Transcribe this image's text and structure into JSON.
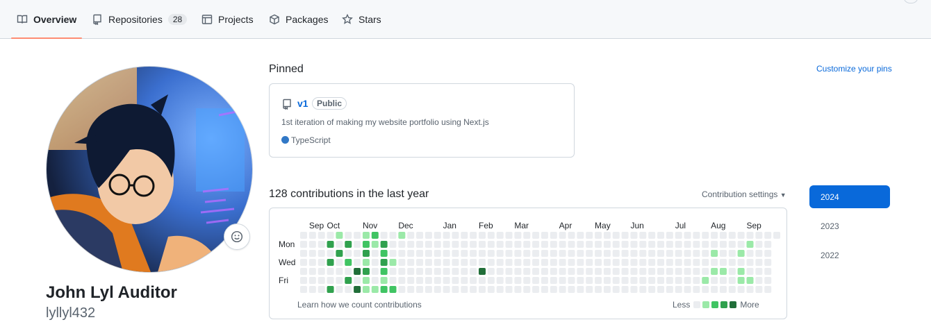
{
  "nav": {
    "tabs": [
      {
        "label": "Overview",
        "icon": "book-icon"
      },
      {
        "label": "Repositories",
        "count": "28",
        "icon": "repo-icon"
      },
      {
        "label": "Projects",
        "icon": "table-icon"
      },
      {
        "label": "Packages",
        "icon": "package-icon"
      },
      {
        "label": "Stars",
        "icon": "star-icon"
      }
    ]
  },
  "profile": {
    "name": "John Lyl Auditor",
    "login": "lyllyl432",
    "status_icon": "smiley-icon"
  },
  "pinned": {
    "title": "Pinned",
    "customize_label": "Customize your pins",
    "repos": [
      {
        "name": "v1",
        "visibility": "Public",
        "description": "1st iteration of making my website portfolio using Next.js",
        "language": "TypeScript",
        "language_color": "#3178c6"
      }
    ]
  },
  "contributions": {
    "title": "128 contributions in the last year",
    "settings_label": "Contribution settings",
    "learn_label": "Learn how we count contributions",
    "legend_less": "Less",
    "legend_more": "More",
    "day_labels": [
      "Mon",
      "Wed",
      "Fri"
    ],
    "months": [
      {
        "label": "Sep",
        "week": 1
      },
      {
        "label": "Oct",
        "week": 3
      },
      {
        "label": "Nov",
        "week": 7
      },
      {
        "label": "Dec",
        "week": 11
      },
      {
        "label": "Jan",
        "week": 16
      },
      {
        "label": "Feb",
        "week": 20
      },
      {
        "label": "Mar",
        "week": 24
      },
      {
        "label": "Apr",
        "week": 29
      },
      {
        "label": "May",
        "week": 33
      },
      {
        "label": "Jun",
        "week": 37
      },
      {
        "label": "Jul",
        "week": 42
      },
      {
        "label": "Aug",
        "week": 46
      },
      {
        "label": "Sep",
        "week": 50
      }
    ],
    "weeks": 54,
    "level_colors": [
      "#ebedf0",
      "#9be9a8",
      "#40c463",
      "#30a14e",
      "#216e39"
    ],
    "active_cells": [
      {
        "week": 11,
        "day": 0,
        "level": 1
      },
      {
        "week": 3,
        "day": 1,
        "level": 3
      },
      {
        "week": 4,
        "day": 0,
        "level": 1
      },
      {
        "week": 5,
        "day": 1,
        "level": 3
      },
      {
        "week": 4,
        "day": 2,
        "level": 3
      },
      {
        "week": 7,
        "day": 0,
        "level": 1
      },
      {
        "week": 8,
        "day": 0,
        "level": 2
      },
      {
        "week": 7,
        "day": 1,
        "level": 2
      },
      {
        "week": 8,
        "day": 1,
        "level": 1
      },
      {
        "week": 9,
        "day": 1,
        "level": 3
      },
      {
        "week": 7,
        "day": 2,
        "level": 3
      },
      {
        "week": 9,
        "day": 2,
        "level": 2
      },
      {
        "week": 3,
        "day": 3,
        "level": 3
      },
      {
        "week": 5,
        "day": 3,
        "level": 2
      },
      {
        "week": 7,
        "day": 3,
        "level": 1
      },
      {
        "week": 9,
        "day": 3,
        "level": 3
      },
      {
        "week": 10,
        "day": 3,
        "level": 1
      },
      {
        "week": 6,
        "day": 4,
        "level": 4
      },
      {
        "week": 7,
        "day": 4,
        "level": 3
      },
      {
        "week": 9,
        "day": 4,
        "level": 2
      },
      {
        "week": 20,
        "day": 4,
        "level": 4
      },
      {
        "week": 5,
        "day": 5,
        "level": 3
      },
      {
        "week": 7,
        "day": 5,
        "level": 1
      },
      {
        "week": 9,
        "day": 5,
        "level": 1
      },
      {
        "week": 3,
        "day": 6,
        "level": 3
      },
      {
        "week": 6,
        "day": 6,
        "level": 4
      },
      {
        "week": 7,
        "day": 6,
        "level": 1
      },
      {
        "week": 8,
        "day": 6,
        "level": 1
      },
      {
        "week": 9,
        "day": 6,
        "level": 2
      },
      {
        "week": 10,
        "day": 6,
        "level": 2
      },
      {
        "week": 50,
        "day": 1,
        "level": 1
      },
      {
        "week": 46,
        "day": 2,
        "level": 1
      },
      {
        "week": 49,
        "day": 2,
        "level": 1
      },
      {
        "week": 46,
        "day": 4,
        "level": 1
      },
      {
        "week": 47,
        "day": 4,
        "level": 1
      },
      {
        "week": 49,
        "day": 4,
        "level": 1
      },
      {
        "week": 45,
        "day": 5,
        "level": 1
      },
      {
        "week": 49,
        "day": 5,
        "level": 1
      },
      {
        "week": 50,
        "day": 5,
        "level": 1
      }
    ]
  },
  "years": [
    "2024",
    "2023",
    "2022"
  ],
  "active_year": "2024"
}
